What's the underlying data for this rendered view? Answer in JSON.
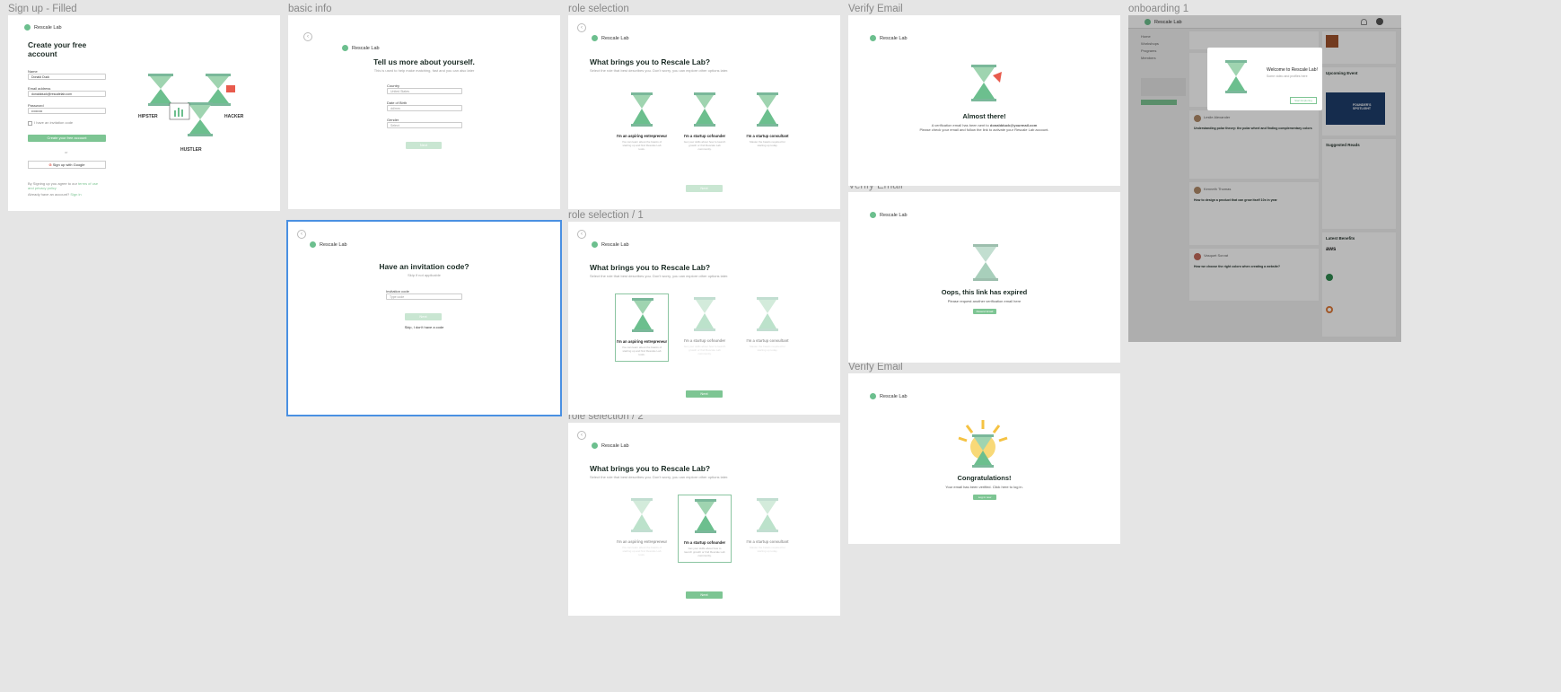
{
  "frames": {
    "signup": {
      "label": "Sign up - Filled",
      "logo": "Rescale Lab",
      "title": "Create your free account",
      "name_label": "Name",
      "name_value": "Donald Duck",
      "email_label": "Email address",
      "email_value": "donaldduck@rescalelab.com",
      "password_label": "Password",
      "password_value": "••••••••••",
      "invite_text": "I have an invitation code",
      "create_btn": "Create your free account",
      "or_text": "or",
      "google_btn": "Sign up with Google",
      "terms_text": "By Signing up you agree to our",
      "terms_link": "terms of use and privacy policy",
      "login_text": "Already have an account?",
      "login_link": "Sign in",
      "role1": "HIPSTER",
      "role2": "HACKER",
      "role3": "HUSTLER"
    },
    "basic_info": {
      "label": "basic info",
      "logo": "Rescale Lab",
      "title": "Tell us more about yourself.",
      "subtitle": "This is used to help make matching, fast and you can also later",
      "country_label": "Country",
      "country_placeholder": "United States",
      "dob_label": "Date of Birth",
      "dob_placeholder": "dd/mm",
      "gender_label": "Gender",
      "gender_placeholder": "Select",
      "next_btn": "Next"
    },
    "invite": {
      "label": "",
      "logo": "Rescale Lab",
      "title": "Have an invitation code?",
      "subtitle": "Skip if not applicable",
      "code_label": "Invitation code",
      "code_placeholder": "Type code",
      "next_btn": "Next",
      "skip_link": "Skip, I don't have a code"
    },
    "role0": {
      "label": "role selection",
      "logo": "Rescale Lab",
      "title": "What brings you to Rescale Lab?",
      "subtitle": "Select the role that best describes you. Don't worry, you can explore other options later.",
      "btn": "Next"
    },
    "role1": {
      "label": "role selection / 1",
      "logo": "Rescale Lab",
      "title": "What brings you to Rescale Lab?",
      "subtitle": "Select the role that best describes you. Don't worry, you can explore other options later.",
      "btn": "Next"
    },
    "role2": {
      "label": "role selection / 2",
      "logo": "Rescale Lab",
      "title": "What brings you to Rescale Lab?",
      "subtitle": "Select the role that best describes you. Don't worry, you can explore other options later.",
      "btn": "Next"
    },
    "roles": [
      {
        "title": "I'm an aspiring entrepreneur",
        "desc": "You can learn about the basics of starting up and find Rescale Lab tools."
      },
      {
        "title": "I'm a startup cofounder",
        "desc": "Get your skills about how to launch growth or find Rescale Lab community."
      },
      {
        "title": "I'm a startup consultant",
        "desc": "Master the basics required for starting up today."
      }
    ],
    "verify1": {
      "label": "Verify Email",
      "logo": "Rescale Lab",
      "title": "Almost there!",
      "line1": "A verification email has been sent to",
      "email": "donaldduck@yourmail.com",
      "line2": "Please check your email and follow the link to activate your Rescale Lab account."
    },
    "verify2": {
      "label": "Verify Email",
      "logo": "Rescale Lab",
      "title": "Oops, this link has expired",
      "line1": "Please request another verification email here",
      "btn": "Resend Email"
    },
    "verify3": {
      "label": "Verify Email",
      "logo": "Rescale Lab",
      "title": "Congratulations!",
      "line1": "Your email has been verified. Click here to log in.",
      "btn": "Log in now"
    },
    "onboarding": {
      "label": "onboarding 1",
      "logo": "Rescale Lab",
      "nav": [
        "Home",
        "Workshops",
        "Programs",
        "Members"
      ],
      "modal_title": "Welcome to Rescale Lab!",
      "modal_text": "Some video and profiles here",
      "modal_btn": "Start Exploring",
      "upcoming": "Upcoming Event",
      "founders": "FOUNDER'S SPOTLIGHT",
      "suggested": "Suggested Reads",
      "latest": "Latest Benefits",
      "aws": "aws",
      "post1_author": "Leslie Alexander",
      "post1_title": "Understanding polar theory: the polar wheel and finding complementary colors",
      "post2_author": "Kenneth Thomas",
      "post2_title": "How to design a product that can grow itself 10x in year",
      "post3_author": "Vasquet Sorvat",
      "post3_title": "How we choose the right colors when creating a website?"
    }
  }
}
